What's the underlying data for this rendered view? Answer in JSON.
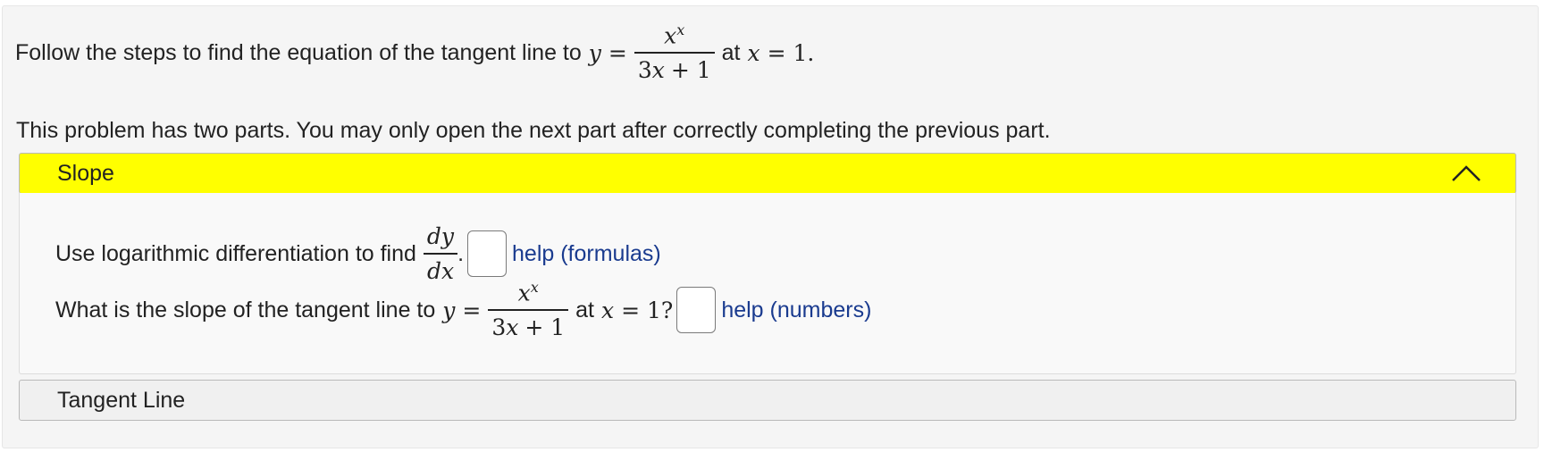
{
  "intro": {
    "prefix": "Follow the steps to find the equation of the tangent line to",
    "y_var": "y",
    "equals": "=",
    "numerator": "x",
    "numerator_exp": "x",
    "denominator_coef": "3",
    "denominator_var": "x",
    "denominator_rest": "+ 1",
    "at_text": "at",
    "x_var": "x",
    "x_value": "= 1."
  },
  "info_text": "This problem has two parts. You may only open the next part after correctly completing the previous part.",
  "parts": [
    {
      "label": "Slope",
      "expanded": true,
      "header_color": "#ffff00",
      "icon": "chevron-up-icon",
      "question1": {
        "prefix": "Use logarithmic differentiation to find",
        "frac_num": "dy",
        "frac_den": "dx",
        "suffix": ".",
        "answer_value": "",
        "help_link": "help (formulas)"
      },
      "question2": {
        "prefix": "What is the slope of the tangent line to",
        "y_var": "y",
        "equals": "=",
        "numerator": "x",
        "numerator_exp": "x",
        "denominator_coef": "3",
        "denominator_var": "x",
        "denominator_rest": "+ 1",
        "at_text": "at",
        "x_var": "x",
        "x_value": "= 1?",
        "answer_value": "",
        "help_link": "help (numbers)"
      }
    },
    {
      "label": "Tangent Line",
      "expanded": false,
      "header_color": "#f0f0f0"
    }
  ],
  "colors": {
    "link": "#1a3b8f",
    "active_header": "#ffff00"
  }
}
